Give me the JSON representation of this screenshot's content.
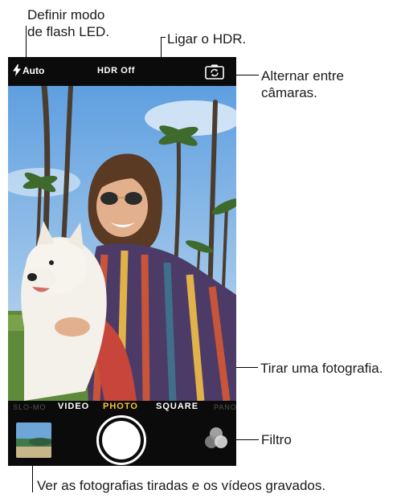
{
  "callouts": {
    "flash": "Definir modo\nde flash LED.",
    "hdr": "Ligar o HDR.",
    "switch_camera": "Alternar entre\ncâmaras.",
    "shutter": "Tirar uma fotografia.",
    "filter": "Filtro",
    "thumbnail": "Ver as fotografias tiradas e os vídeos gravados."
  },
  "camera": {
    "flash_label": "Auto",
    "hdr_label": "HDR Off",
    "modes": [
      "SLO-MO",
      "VIDEO",
      "PHOTO",
      "SQUARE",
      "PANO"
    ],
    "active_mode": "PHOTO"
  },
  "colors": {
    "active_mode": "#f4c430",
    "bar": "#0b0b0b"
  },
  "icons": {
    "flash": "lightning-bolt-icon",
    "switch_camera": "camera-rotate-icon",
    "shutter": "shutter-button",
    "filter": "filter-circles-icon"
  }
}
